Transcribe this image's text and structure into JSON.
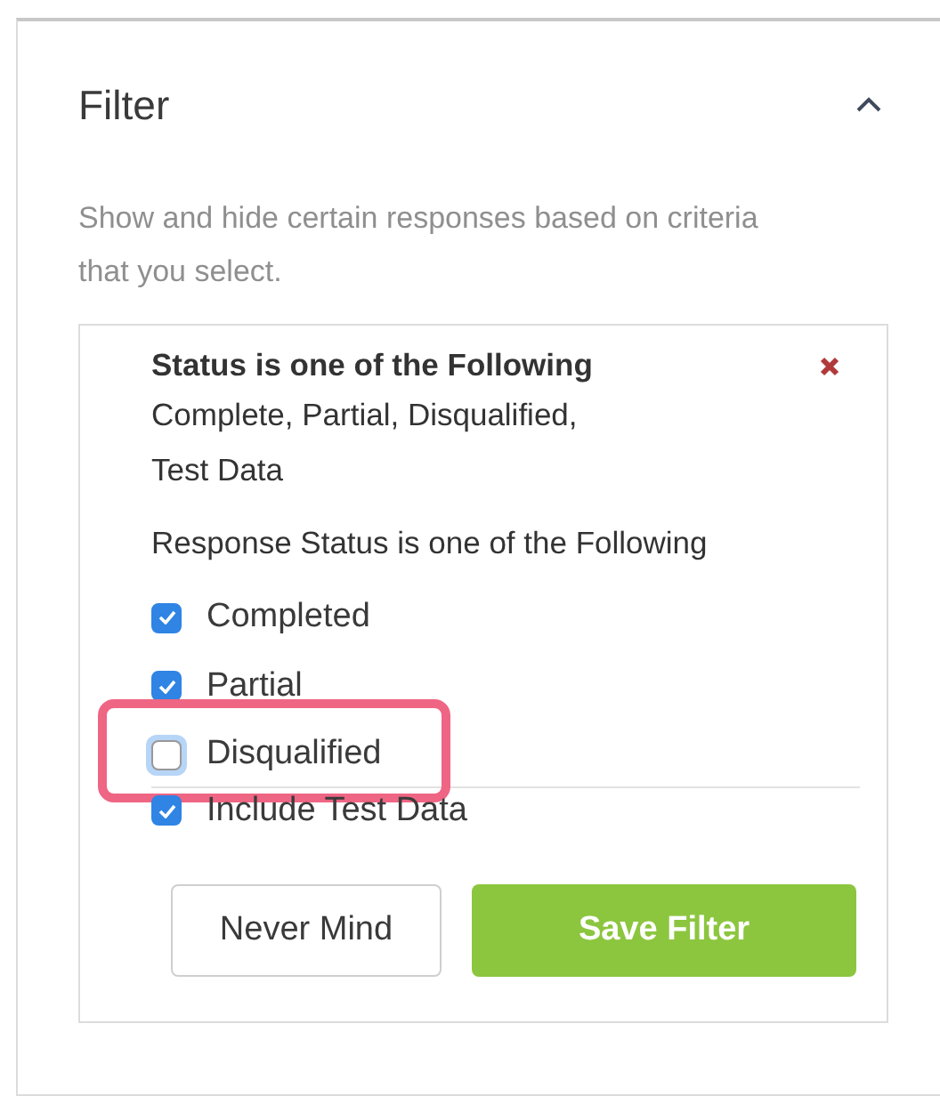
{
  "panel": {
    "title": "Filter",
    "expanded": true,
    "description": "Show and hide certain responses based on criteria that you select."
  },
  "filter": {
    "title": "Status is one of the Following",
    "summary": "Complete, Partial, Disqualified,\nTest Data",
    "question": "Response Status is one of the Following",
    "options": [
      {
        "label": "Completed",
        "checked": true,
        "highlighted": false
      },
      {
        "label": "Partial",
        "checked": true,
        "highlighted": false
      },
      {
        "label": "Disqualified",
        "checked": false,
        "focused": true,
        "highlighted": true
      }
    ],
    "include_test_data": {
      "label": "Include Test Data",
      "checked": true
    }
  },
  "buttons": [
    {
      "label": "Never Mind",
      "kind": "secondary"
    },
    {
      "label": "Save Filter",
      "kind": "primary"
    }
  ]
}
